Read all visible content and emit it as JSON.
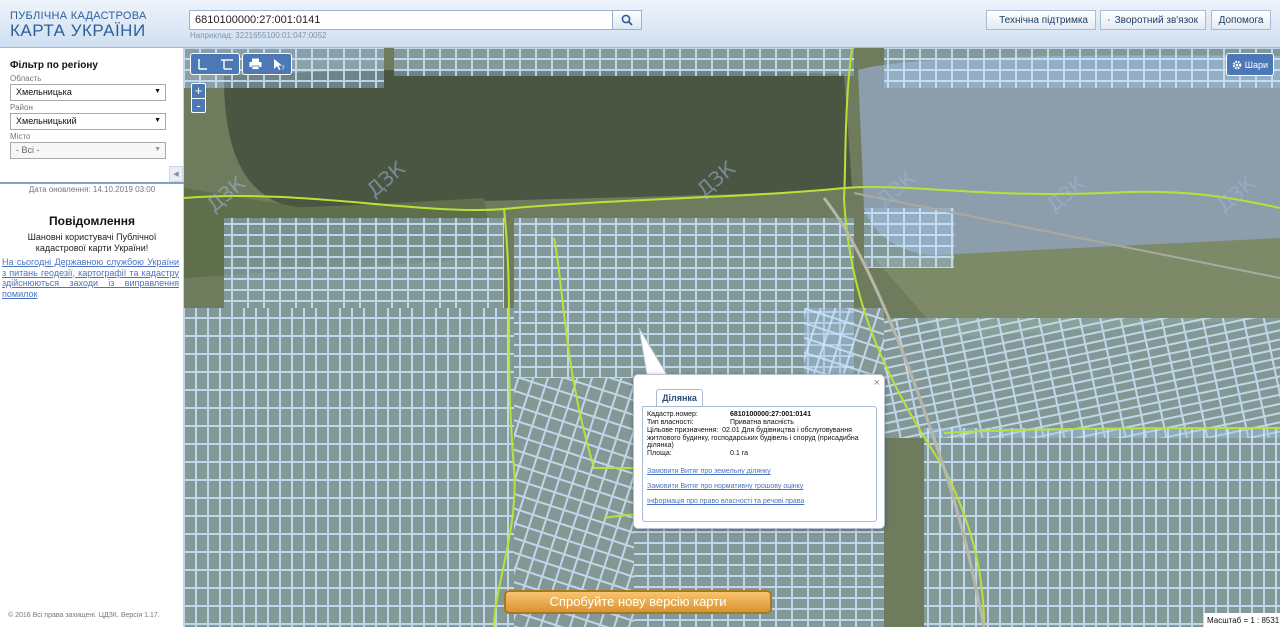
{
  "header": {
    "logo_line1": "ПУБЛІЧНА КАДАСТРОВА",
    "logo_line2": "КАРТА УКРАЇНИ",
    "search_value": "6810100000:27:001:0141",
    "search_hint": "Наприклад: 3221655100:01:047:0052",
    "buttons": {
      "support": "Технічна підтримка",
      "feedback": "Зворотний зв'язок",
      "help": "Допомога"
    }
  },
  "sidebar": {
    "filter_title": "Фільтр по регіону",
    "region_label": "Область",
    "region_value": "Хмельницька",
    "district_label": "Район",
    "district_value": "Хмельницький",
    "city_label": "Місто",
    "city_value": "- Всі -",
    "update_date": "Дата оновлення: 14.10.2019 03:00",
    "notice_title": "Повідомлення",
    "notice_text": "Шановні користувачі Публічної кадастрової карти України!",
    "notice_link": "На сьогодні Державною службою України з питань геодезії, картографії та кадастру здійснюються заходи із виправлення помилок",
    "copyright": "© 2016 Всі права захищені. ЦДЗК. Версія 1.17."
  },
  "map": {
    "layers_label": "Шари",
    "scale_text": "Масштаб = 1 : 8531",
    "try_new_label": "Спробуйте нову версію карти",
    "zoom_in": "+",
    "zoom_out": "-",
    "watermark": "ДЗК",
    "popup": {
      "tab": "Ділянка",
      "close": "×",
      "rows": {
        "cadastral_key": "Кадастр.номер:",
        "cadastral_value": "6810100000:27:001:0141",
        "ownership_key": "Тип власності:",
        "ownership_value": "Приватна власність",
        "purpose_key": "Цільове призначення:",
        "purpose_value": "02.01 Для будівництва і обслуговування житлового будинку, господарських будівель і споруд (присадибна ділянка)",
        "area_key": "Площа:",
        "area_value": "0.1 га"
      },
      "links": {
        "order_land": "Замовити Витяг про земельну ділянку",
        "order_valuation": "Замовити Витяг про нормативну грошову оцінку",
        "ownership_info": "Інформація про право власності та речові права"
      }
    }
  }
}
